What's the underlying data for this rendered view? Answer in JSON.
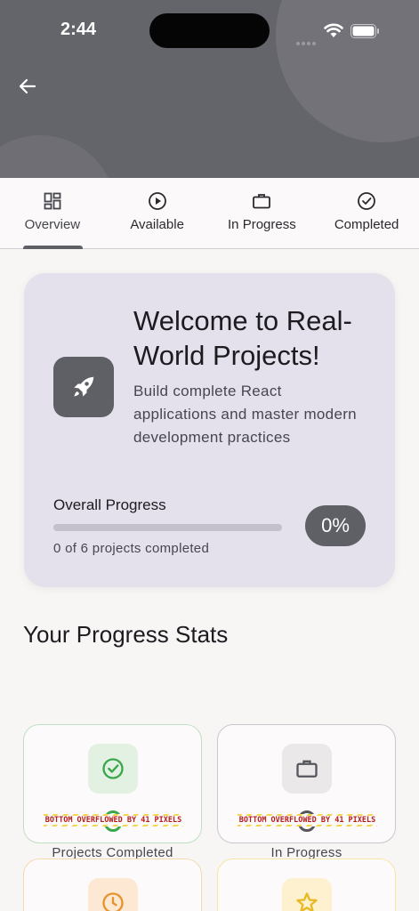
{
  "status_bar": {
    "time": "2:44"
  },
  "tabs": [
    {
      "label": "Overview",
      "icon": "grid-icon",
      "active": true
    },
    {
      "label": "Available",
      "icon": "play-circle-icon",
      "active": false
    },
    {
      "label": "In Progress",
      "icon": "briefcase-icon",
      "active": false
    },
    {
      "label": "Completed",
      "icon": "check-circle-icon",
      "active": false
    }
  ],
  "welcome": {
    "title": "Welcome to Real-World Projects!",
    "subtitle": "Build complete React applications and master modern development practices",
    "progress_label": "Overall Progress",
    "progress_fraction": 0,
    "progress_count": "0 of 6 projects completed",
    "percent": "0%"
  },
  "stats": {
    "title": "Your Progress Stats",
    "overflow_message": "BOTTOM OVERFLOWED BY 41 PIXELS",
    "cards": [
      {
        "label": "Projects Completed",
        "icon": "check-circle-icon",
        "accent": "#3aa84a"
      },
      {
        "label": "In Progress",
        "icon": "briefcase-icon",
        "accent": "#55555c"
      },
      {
        "label": "",
        "icon": "clock-icon",
        "accent": "#e8922b"
      },
      {
        "label": "",
        "icon": "star-icon",
        "accent": "#e8b923"
      }
    ]
  },
  "colors": {
    "header": "#64646b",
    "primary": "#5f5f66",
    "card": "#e4e1ec"
  }
}
